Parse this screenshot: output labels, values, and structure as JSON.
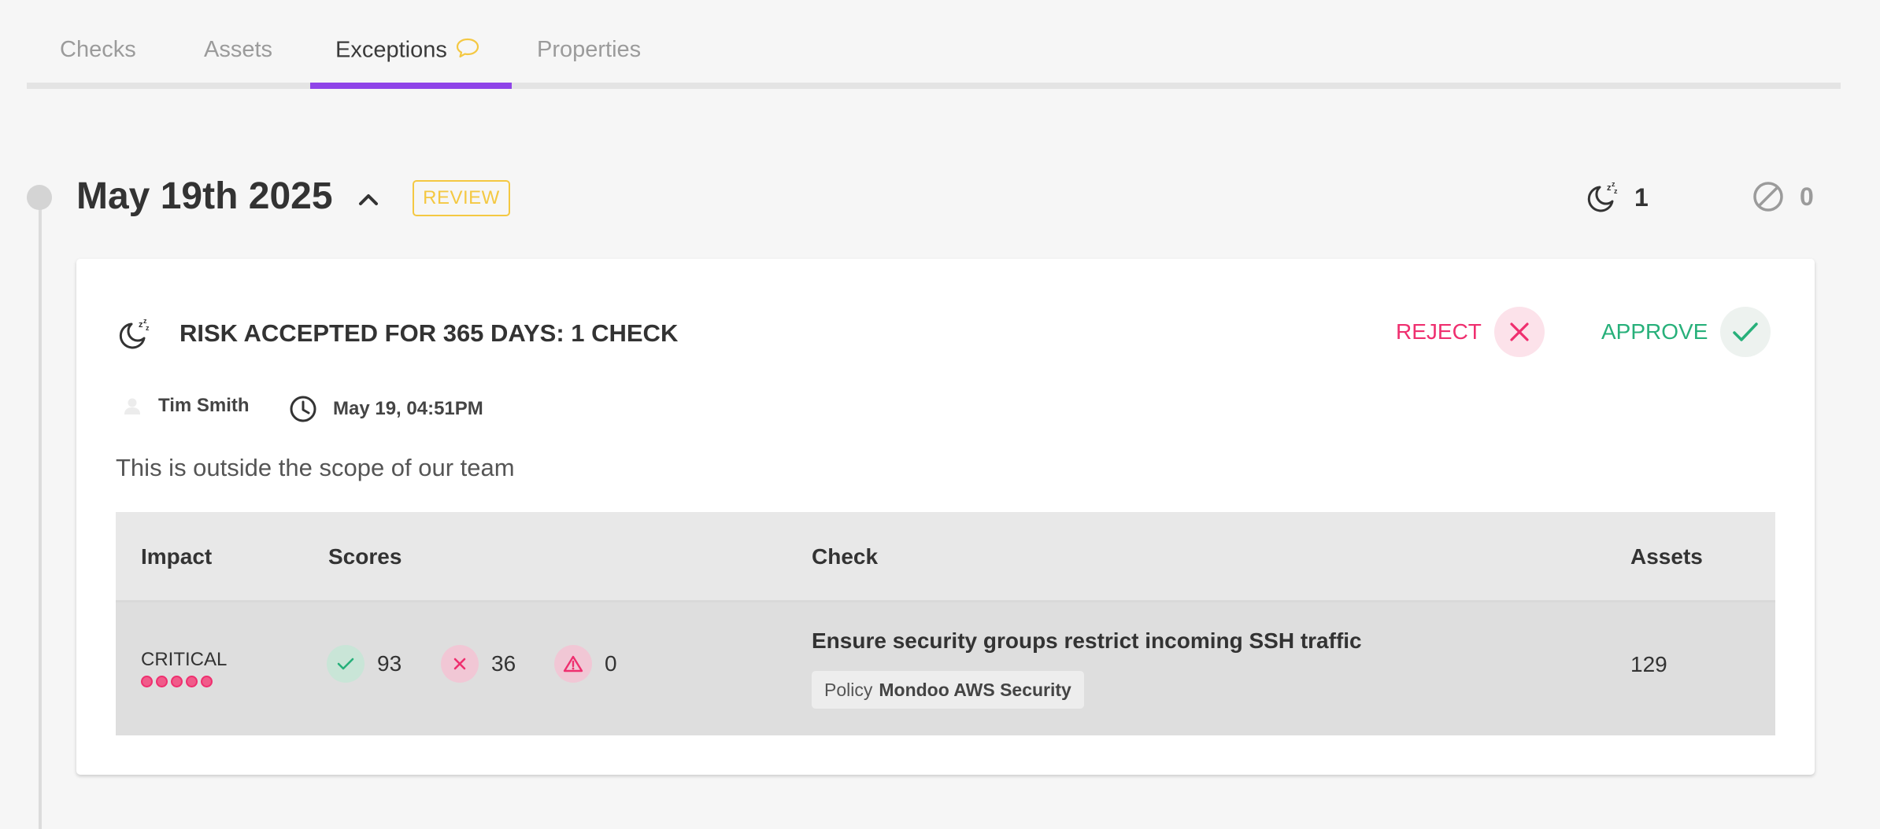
{
  "tabs": [
    {
      "label": "Checks"
    },
    {
      "label": "Assets"
    },
    {
      "label": "Exceptions",
      "icon": "comment-icon",
      "active": true
    },
    {
      "label": "Properties"
    }
  ],
  "colors": {
    "accent": "#8f44e8",
    "review": "#f4c842",
    "reject": "#ef2f6f",
    "approve": "#27b07a"
  },
  "group": {
    "date": "May 19th 2025",
    "status_badge": "REVIEW",
    "snoozed_count": "1",
    "disabled_count": "0"
  },
  "exception": {
    "title": "RISK ACCEPTED FOR 365 DAYS: 1 CHECK",
    "reject_label": "REJECT",
    "approve_label": "APPROVE",
    "author": "Tim Smith",
    "timestamp": "May 19, 04:51PM",
    "justification": "This is outside the scope of our team",
    "table": {
      "headers": {
        "impact": "Impact",
        "scores": "Scores",
        "check": "Check",
        "assets": "Assets"
      },
      "rows": [
        {
          "impact": "CRITICAL",
          "impact_level": 5,
          "scores": {
            "pass": "93",
            "fail": "36",
            "error": "0"
          },
          "check": "Ensure security groups restrict incoming SSH traffic",
          "policy_prefix": "Policy",
          "policy_name": "Mondoo AWS Security",
          "assets": "129"
        }
      ]
    }
  }
}
